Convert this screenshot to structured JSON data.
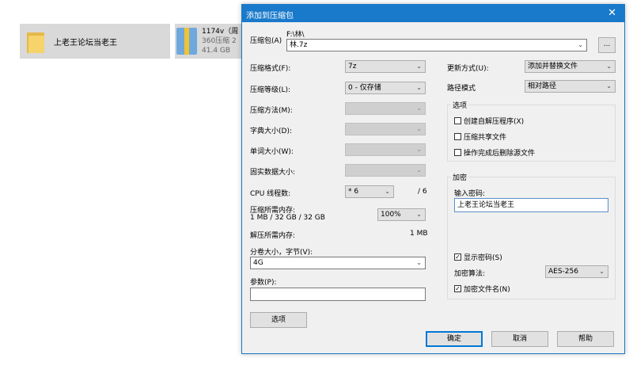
{
  "background": {
    "tile1_name": "上老王论坛当老王",
    "tile2_name": "1174v（周",
    "tile2_sub1": "360压缩 2",
    "tile2_sub2": "41.4 GB"
  },
  "dialog": {
    "title": "添加到压缩包",
    "close_icon": "✕",
    "archive_label": "压缩包(A)",
    "archive_path": "F:\\林\\",
    "archive_name": "林.7z",
    "browse_label": "...",
    "format_label": "压缩格式(F):",
    "format_value": "7z",
    "level_label": "压缩等级(L):",
    "level_value": "0 - 仅存储",
    "method_label": "压缩方法(M):",
    "dict_label": "字典大小(D):",
    "word_label": "单词大小(W):",
    "solid_label": "固实数据大小:",
    "cpu_label": "CPU 线程数:",
    "cpu_value": "* 6",
    "cpu_total": "/ 6",
    "mem_comp_label": "压缩所需内存:",
    "mem_comp_value": "1 MB / 32 GB / 32 GB",
    "mem_percent": "100%",
    "mem_decomp_label": "解压所需内存:",
    "mem_decomp_value": "1 MB",
    "volume_label": "分卷大小，字节(V):",
    "volume_value": "4G",
    "params_label": "参数(P):",
    "params_value": "",
    "options_button": "选项",
    "update_label": "更新方式(U):",
    "update_value": "添加并替换文件",
    "path_label": "路径模式",
    "path_value": "相对路径",
    "options_group": "选项",
    "opt_sfx": "创建自解压程序(X)",
    "opt_shared": "压缩共享文件",
    "opt_delete": "操作完成后删除源文件",
    "encrypt_group": "加密",
    "password_label": "输入密码:",
    "password_value": "上老王论坛当老王",
    "show_password": "显示密码(S)",
    "enc_method_label": "加密算法:",
    "enc_method_value": "AES-256",
    "encrypt_names": "加密文件名(N)",
    "ok": "确定",
    "cancel": "取消",
    "help": "帮助",
    "caret": "⌄",
    "check": "✓"
  }
}
